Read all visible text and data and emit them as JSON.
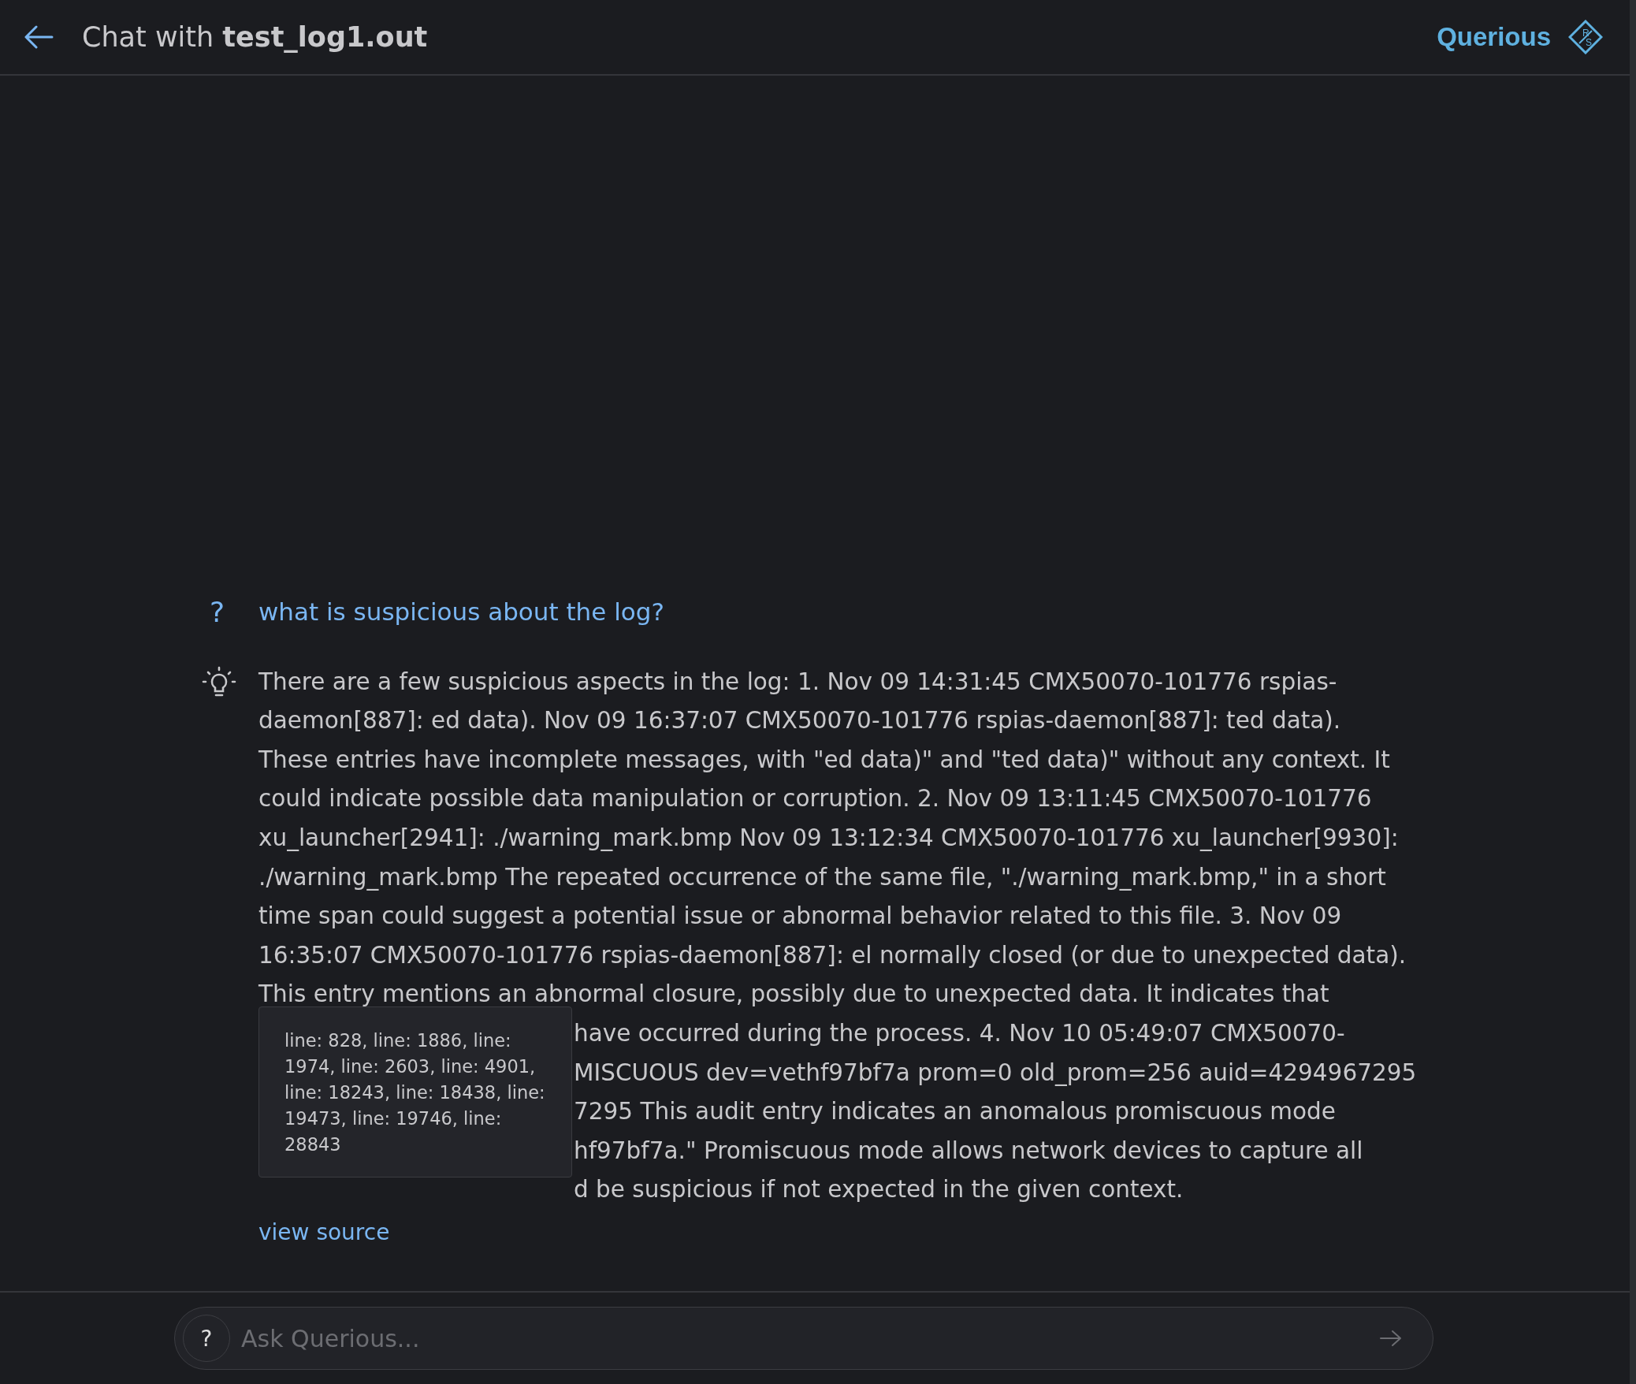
{
  "header": {
    "title_prefix": "Chat with",
    "title_file": "test_log1.out",
    "brand": "Querious",
    "logo_letters": [
      "R",
      "S"
    ]
  },
  "question": {
    "marker": "?",
    "text": "what is suspicious about the log?"
  },
  "answer": {
    "lines": [
      {
        "text": "There are a few suspicious aspects in the log: 1. Nov 09 14:31:45 CMX50070-101776 rspias-",
        "covered": false
      },
      {
        "text": "daemon[887]: ed data). Nov 09 16:37:07 CMX50070-101776 rspias-daemon[887]: ted data).",
        "covered": false
      },
      {
        "text": "These entries have incomplete messages, with \"ed data)\" and \"ted data)\" without any context. It",
        "covered": false
      },
      {
        "text": "could indicate possible data manipulation or corruption. 2. Nov 09 13:11:45 CMX50070-101776",
        "covered": false
      },
      {
        "text": "xu_launcher[2941]: ./warning_mark.bmp Nov 09 13:12:34 CMX50070-101776 xu_launcher[9930]:",
        "covered": false
      },
      {
        "text": "./warning_mark.bmp The repeated occurrence of the same file, \"./warning_mark.bmp,\" in a short",
        "covered": false
      },
      {
        "text": "time span could suggest a potential issue or abnormal behavior related to this file. 3. Nov 09",
        "covered": false
      },
      {
        "text": "16:35:07 CMX50070-101776 rspias-daemon[887]: el normally closed (or due to unexpected data).",
        "covered": false
      },
      {
        "text": "This entry mentions an abnormal closure, possibly due to unexpected data. It indicates that",
        "covered": false
      },
      {
        "text": "have occurred during the process. 4. Nov 10 05:49:07 CMX50070-",
        "covered": true
      },
      {
        "text": "MISCUOUS dev=vethf97bf7a prom=0 old_prom=256 auid=4294967295",
        "covered": true
      },
      {
        "text": "7295 This audit entry indicates an anomalous promiscuous mode",
        "covered": true
      },
      {
        "text": "hf97bf7a.\" Promiscuous mode allows network devices to capture all",
        "covered": true
      },
      {
        "text": "d be suspicious if not expected in the given context.",
        "covered": true
      }
    ],
    "source_link": "view source",
    "tooltip": "line: 828, line: 1886, line: 1974, line: 2603, line: 4901, line: 18243, line: 18438, line: 19473, line: 19746, line: 28843"
  },
  "input": {
    "help": "?",
    "placeholder": "Ask Querious..."
  }
}
